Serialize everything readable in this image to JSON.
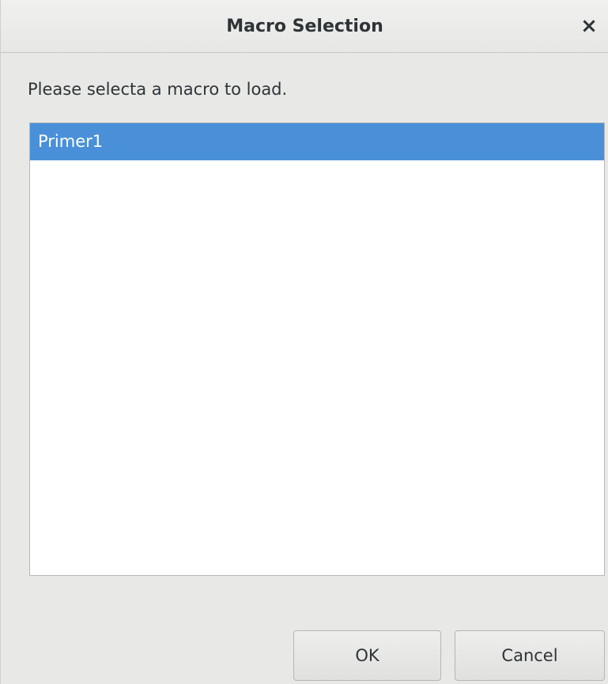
{
  "window": {
    "title": "Macro Selection",
    "close_glyph": "×"
  },
  "prompt": "Please selecta a macro to load.",
  "macros": [
    {
      "label": "Primer1",
      "selected": true
    }
  ],
  "buttons": {
    "ok_label": "OK",
    "cancel_label": "Cancel"
  },
  "colors": {
    "selection": "#4a90d9",
    "background": "#e8e8e7"
  },
  "icons": {
    "close": "close-icon"
  }
}
